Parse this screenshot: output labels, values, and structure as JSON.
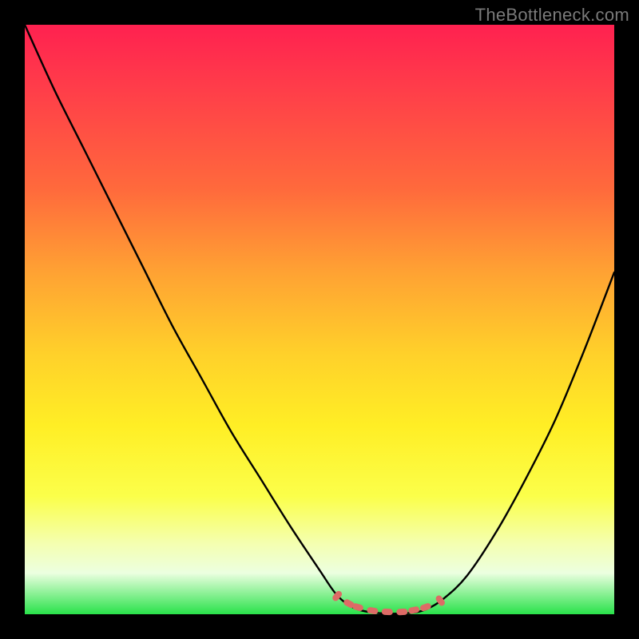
{
  "watermark": "TheBottleneck.com",
  "chart_data": {
    "type": "line",
    "title": "",
    "xlabel": "",
    "ylabel": "",
    "xlim": [
      0,
      100
    ],
    "ylim": [
      0,
      100
    ],
    "series": [
      {
        "name": "bottleneck-curve",
        "x": [
          0,
          5,
          10,
          15,
          20,
          25,
          30,
          35,
          40,
          45,
          50,
          53,
          56,
          60,
          65,
          68,
          71,
          75,
          80,
          85,
          90,
          95,
          100
        ],
        "values": [
          100,
          89,
          79,
          69,
          59,
          49,
          40,
          31,
          23,
          15,
          7.5,
          3.2,
          1.0,
          0.2,
          0.2,
          0.8,
          2.6,
          6.5,
          14,
          23,
          33,
          45,
          58
        ]
      },
      {
        "name": "optimal-band-markers",
        "x": [
          53,
          55,
          56.5,
          59,
          61.5,
          64,
          66,
          68,
          70.5
        ],
        "values": [
          3.1,
          1.8,
          1.2,
          0.6,
          0.4,
          0.4,
          0.7,
          1.2,
          2.3
        ]
      }
    ],
    "colors": {
      "curve": "#000000",
      "markers": "#dd6b66",
      "gradient_stops": [
        "#ff2150",
        "#ff6a3c",
        "#ffd12a",
        "#fbff4a",
        "#29e24a"
      ]
    }
  }
}
